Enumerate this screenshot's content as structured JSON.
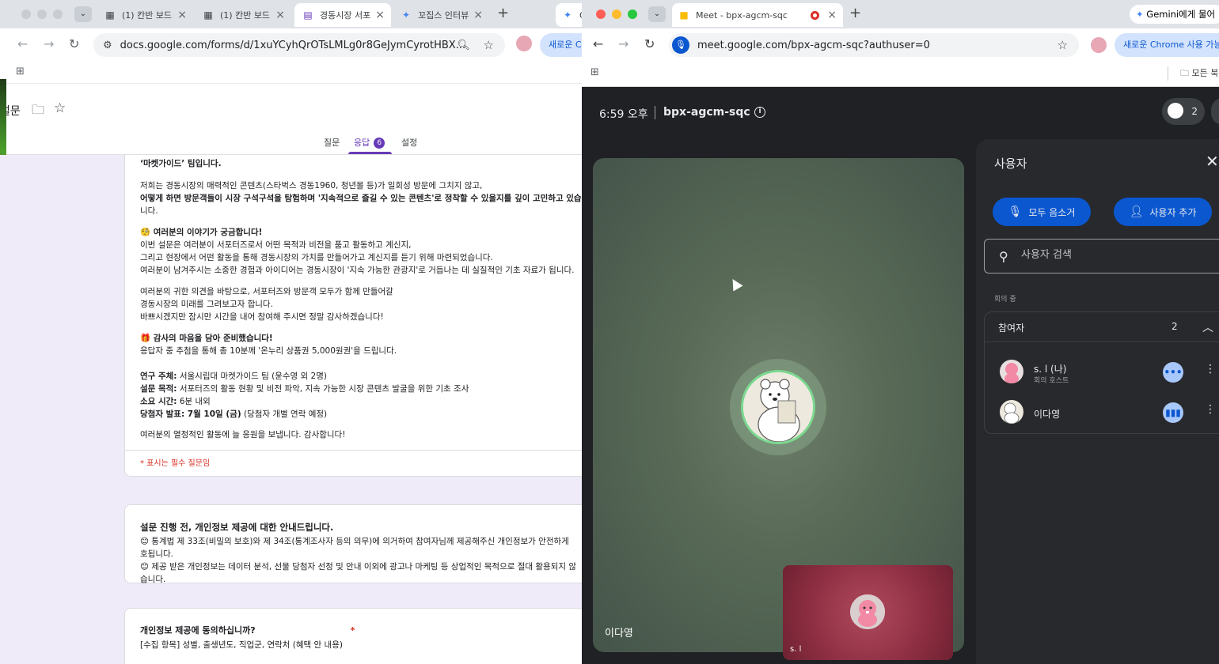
{
  "left_window": {
    "tabs": [
      {
        "title": "(1) 칸반 보드",
        "icon": "board-icon"
      },
      {
        "title": "(1) 칸반 보드",
        "icon": "board-icon"
      },
      {
        "title": "경동시장 서포",
        "icon": "forms-icon",
        "active": true
      },
      {
        "title": "꼬집스 인터뷰",
        "icon": "gemini-icon"
      },
      {
        "title": "G",
        "icon": "gemini-icon"
      }
    ],
    "url": "docs.google.com/forms/d/1xuYCyhQrOTsLMLg0r8GeJymCyrotHBX...",
    "profile_button": "새로운 C",
    "form": {
      "title": "설문",
      "tabs": {
        "questions": "질문",
        "responses": "응답",
        "responses_badge": "6",
        "settings": "설정"
      },
      "intro_lines": [
        "‘마켓가이드’ 팀입니다.",
        "저희는 경동시장의 매력적인 콘텐츠(스타벅스 경동1960, 청년몰 등)가 일회성 방문에 그치지 않고,",
        "어떻게 하면 방문객들이 시장 구석구석을 탐험하며 '지속적으로 즐길 수 있는 콘텐츠'로 정착할 수 있을지를 깊이 고민하고 있습",
        "니다.",
        "🧐 여러분의 이야기가 궁금합니다!",
        "이번 설문은 여러분이 서포터즈로서 어떤 목적과 비전을 품고 활동하고 계신지,",
        "그리고 현장에서 어떤 활동을 통해 경동시장의 가치를 만들어가고 계신지를 듣기 위해 마련되었습니다.",
        "여러분이 남겨주시는 소중한 경험과 아이디어는 경동시장이 '지속 가능한 관광지'로 거듭나는 데 실질적인 기초 자료가 됩니다.",
        "여러분의 귀한 의견을 바탕으로, 서포터즈와 방문객 모두가 함께 만들어갈",
        "경동시장의 미래를 그려보고자 합니다.",
        "바쁘시겠지만 잠시만 시간을 내어 참여해 주시면 정말 감사하겠습니다!",
        "🎁 감사의 마음을 담아 준비했습니다!",
        "응답자 중 추첨을 통해 총 10분께 '온누리 상품권 5,000원권'을 드립니다."
      ],
      "meta": {
        "researcher_label": "연구 주체:",
        "researcher": "서울시립대 마켓가이드 팀 (윤수영 외 2명)",
        "purpose_label": "설문 목적:",
        "purpose": "서포터즈의 활동 현황 및 비전 파악, 지속 가능한 시장 콘텐츠 발굴을 위한 기초 조사",
        "duration_label": "소요 시간:",
        "duration": "6분 내외",
        "winner_label": "당첨자 발표: 7월 10일 (금)",
        "winner": "(당첨자 개별 연락 예정)"
      },
      "closing": "여러분의 열정적인 활동에 늘 응원을 보냅니다. 감사합니다!",
      "required_note": "* 표시는 필수 질문임",
      "privacy_title": "설문 진행 전, 개인정보 제공에 대한 안내드립니다.",
      "privacy_lines": [
        "😊 통계법 제 33조(비밀의 보호)와 제 34조(통계조사자 등의 의무)에 의거하여 참여자님께 제공해주신 개인정보가 안전하게",
        "호됩니다.",
        "😊 제공 받은 개인정보는 데이터 분석, 선물 당첨자 선정 및 안내 이외에 광고나 마케팅 등 상업적인 목적으로 절대 활용되지 않",
        "습니다."
      ],
      "consent_question": "개인정보 제공에 동의하십니까?",
      "consent_required": "*",
      "consent_desc": "[수집 항목] 성별, 출생년도, 직업군, 연락처 (혜택 안 내용)"
    }
  },
  "right_window": {
    "tab_title": "Meet - bpx-agcm-sqc",
    "gemini_button": "Gemini에게 물어",
    "url": "meet.google.com/bpx-agcm-sqc?authuser=0",
    "chrome_button": "새로운 Chrome 사용 가능",
    "bookmarks_label": "모든 북",
    "meet": {
      "time": "6:59 오후",
      "code": "bpx-agcm-sqc",
      "participant_count": "2",
      "stage_name": "이다영",
      "self_name": "s. l",
      "panel": {
        "title": "사용자",
        "mute_all": "모두 음소거",
        "add_user": "사용자 추가",
        "search_placeholder": "사용자 검색",
        "section": "회의 중",
        "group_label": "참여자",
        "group_count": "2",
        "participants": [
          {
            "name": "s. l (나)",
            "role": "회의 호스트",
            "status": "more-icon"
          },
          {
            "name": "이다영",
            "role": "",
            "status": "speaking-icon"
          }
        ]
      }
    }
  },
  "colors": {
    "forms_purple": "#673ab7",
    "meet_blue": "#0b57d0",
    "meet_bg": "#202124"
  }
}
